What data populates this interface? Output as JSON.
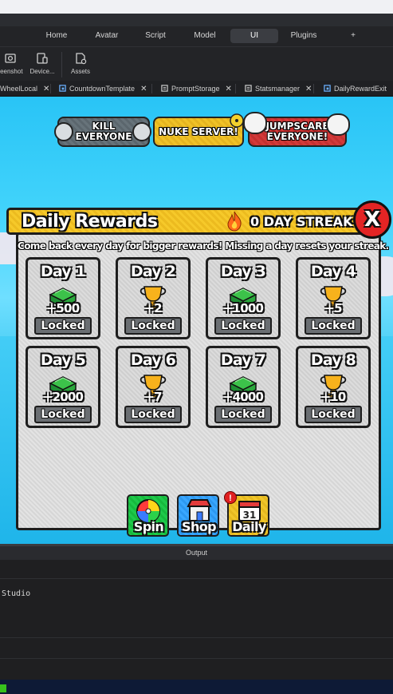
{
  "ribbon": {
    "tabs": [
      {
        "label": "Home",
        "active": false
      },
      {
        "label": "Avatar",
        "active": false
      },
      {
        "label": "Script",
        "active": false
      },
      {
        "label": "Model",
        "active": false
      },
      {
        "label": "UI",
        "active": true
      },
      {
        "label": "Plugins",
        "active": false
      },
      {
        "label": "+",
        "active": false
      }
    ]
  },
  "tools": {
    "screenshot": "reenshot",
    "device": "Device...",
    "assets": "Assets"
  },
  "file_tabs": [
    {
      "label": "WheelLocal"
    },
    {
      "label": "CountdownTemplate"
    },
    {
      "label": "PromptStorage"
    },
    {
      "label": "Statsmanager"
    },
    {
      "label": "DailyRewardExit"
    }
  ],
  "game": {
    "top_buttons": {
      "kill": "KILL\nEVERYONE",
      "nuke": "NUKE SERVER!",
      "jumpscare": "JUMPSCARE\nEVERYONE!"
    },
    "panel": {
      "title": "Daily Rewards",
      "streak": "0 DAY STREAK",
      "close": "X",
      "subtitle": "Come back every day for bigger rewards! Missing a day resets your streak."
    },
    "days": [
      {
        "title": "Day 1",
        "amount": "+500",
        "status": "Locked",
        "reward": "cash"
      },
      {
        "title": "Day 2",
        "amount": "+2",
        "status": "Locked",
        "reward": "trophy"
      },
      {
        "title": "Day 3",
        "amount": "+1000",
        "status": "Locked",
        "reward": "cash"
      },
      {
        "title": "Day 4",
        "amount": "+5",
        "status": "Locked",
        "reward": "trophy"
      },
      {
        "title": "Day 5",
        "amount": "+2000",
        "status": "Locked",
        "reward": "cash"
      },
      {
        "title": "Day 6",
        "amount": "+7",
        "status": "Locked",
        "reward": "trophy"
      },
      {
        "title": "Day 7",
        "amount": "+4000",
        "status": "Locked",
        "reward": "cash"
      },
      {
        "title": "Day 8",
        "amount": "+10",
        "status": "Locked",
        "reward": "trophy"
      }
    ],
    "hud": {
      "spin": "Spin",
      "shop": "Shop",
      "daily": "Daily",
      "daily_badge": "!"
    }
  },
  "output": {
    "title": "Output",
    "line": "Studio"
  },
  "colors": {
    "accent_yellow": "#f6c92a",
    "close_red": "#e32424",
    "hud_green": "#1fc94b",
    "sky": "#41d3fb"
  }
}
